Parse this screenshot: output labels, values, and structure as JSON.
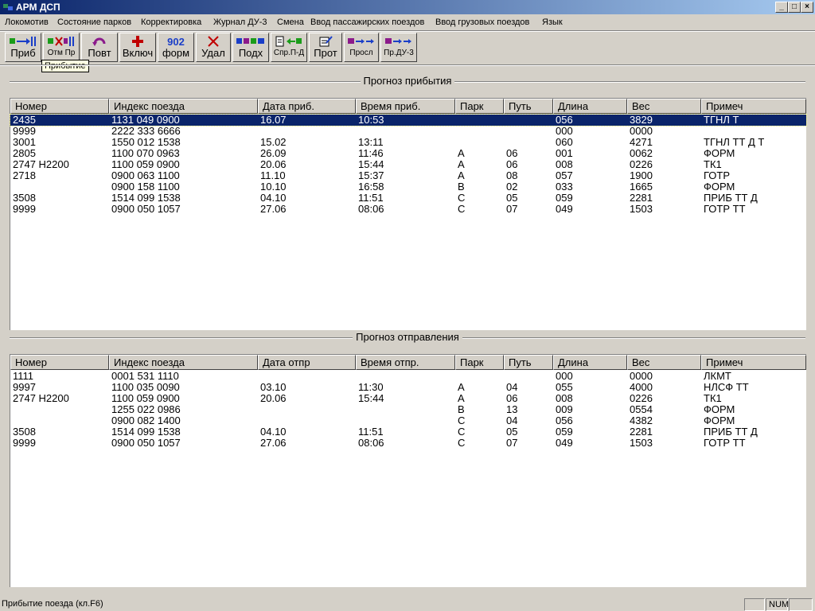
{
  "window": {
    "title": "АРМ ДСП"
  },
  "menu": [
    "Локомотив",
    "Состояние парков",
    "Корректировка",
    "Журнал ДУ-3",
    "Смена",
    "Ввод пассажирских поездов",
    "Ввод грузовых поездов",
    "Язык"
  ],
  "toolbar": {
    "buttons": [
      {
        "label": "Приб",
        "icon": "arrival-train-icon"
      },
      {
        "label": "Отм Пр",
        "icon": "cancel-arrival-icon"
      },
      {
        "label": "Повт",
        "icon": "repeat-icon"
      },
      {
        "label": "Включ",
        "icon": "add-icon"
      },
      {
        "label": "форм",
        "number": "902",
        "icon": "formation-number-icon"
      },
      {
        "label": "Удал",
        "icon": "delete-icon"
      },
      {
        "label": "Подх",
        "icon": "approach-train-icon"
      },
      {
        "label": "Спр.П-Д",
        "icon": "reference-icon"
      },
      {
        "label": "Прот",
        "icon": "protocol-icon"
      },
      {
        "label": "Просл",
        "icon": "track-train-icon"
      },
      {
        "label": "Пр.ДУ-3",
        "icon": "du3-train-icon"
      }
    ],
    "tooltip": "Прибытие"
  },
  "columns": {
    "arrival": [
      "Номер",
      "Индекс поезда",
      "Дата приб.",
      "Время приб.",
      "Парк",
      "Путь",
      "Длина",
      "Вес",
      "Примеч"
    ],
    "departure": [
      "Номер",
      "Индекс поезда",
      "Дата отпр",
      "Время отпр.",
      "Парк",
      "Путь",
      "Длина",
      "Вес",
      "Примеч"
    ]
  },
  "arrival": {
    "title": "Прогноз прибытия",
    "selected_row": 0,
    "rows": [
      [
        "2435",
        "1131 049 0900",
        "16.07",
        "10:53",
        "",
        "",
        "056",
        "3829",
        "ТГНЛ    Т"
      ],
      [
        "9999",
        "2222 333 6666",
        "",
        "",
        "",
        "",
        "000",
        "0000",
        ""
      ],
      [
        "3001",
        "1550 012 1538",
        "15.02",
        "13:11",
        "",
        "",
        "060",
        "4271",
        "ТГНЛ ТТ Д Т"
      ],
      [
        "2805",
        "1100 070 0963",
        "26.09",
        "11:46",
        "А",
        "06",
        "001",
        "0062",
        "ФОРМ"
      ],
      [
        "2747 Н2200",
        "1100 059 0900",
        "20.06",
        "15:44",
        "А",
        "06",
        "008",
        "0226",
        "ТК1"
      ],
      [
        "2718",
        "0900 063 1100",
        "11.10",
        "15:37",
        "А",
        "08",
        "057",
        "1900",
        "ГОТР"
      ],
      [
        "",
        "0900 158 1100",
        "10.10",
        "16:58",
        "В",
        "02",
        "033",
        "1665",
        "ФОРМ"
      ],
      [
        "3508",
        "1514 099 1538",
        "04.10",
        "11:51",
        "С",
        "05",
        "059",
        "2281",
        "ПРИБ ТТ Д"
      ],
      [
        "9999",
        "0900 050 1057",
        "27.06",
        "08:06",
        "С",
        "07",
        "049",
        "1503",
        "ГОТР ТТ"
      ]
    ]
  },
  "departure": {
    "title": "Прогноз отправления",
    "rows": [
      [
        "1111",
        "0001 531 1110",
        "",
        "",
        "",
        "",
        "000",
        "0000",
        "ЛКМТ"
      ],
      [
        "9997",
        "1100 035 0090",
        "03.10",
        "11:30",
        "А",
        "04",
        "055",
        "4000",
        "НЛСФ ТТ"
      ],
      [
        "2747 Н2200",
        "1100 059 0900",
        "20.06",
        "15:44",
        "А",
        "06",
        "008",
        "0226",
        "ТК1"
      ],
      [
        "",
        "1255 022 0986",
        "",
        "",
        "В",
        "13",
        "009",
        "0554",
        "ФОРМ"
      ],
      [
        "",
        "0900 082 1400",
        "",
        "",
        "С",
        "04",
        "056",
        "4382",
        "ФОРМ"
      ],
      [
        "3508",
        "1514 099 1538",
        "04.10",
        "11:51",
        "С",
        "05",
        "059",
        "2281",
        "ПРИБ ТТ Д"
      ],
      [
        "9999",
        "0900 050 1057",
        "27.06",
        "08:06",
        "С",
        "07",
        "049",
        "1503",
        "ГОТР ТТ"
      ]
    ]
  },
  "status": {
    "text": "Прибытие поезда (кл.F6)",
    "panes": [
      "",
      "NUM",
      ""
    ]
  }
}
